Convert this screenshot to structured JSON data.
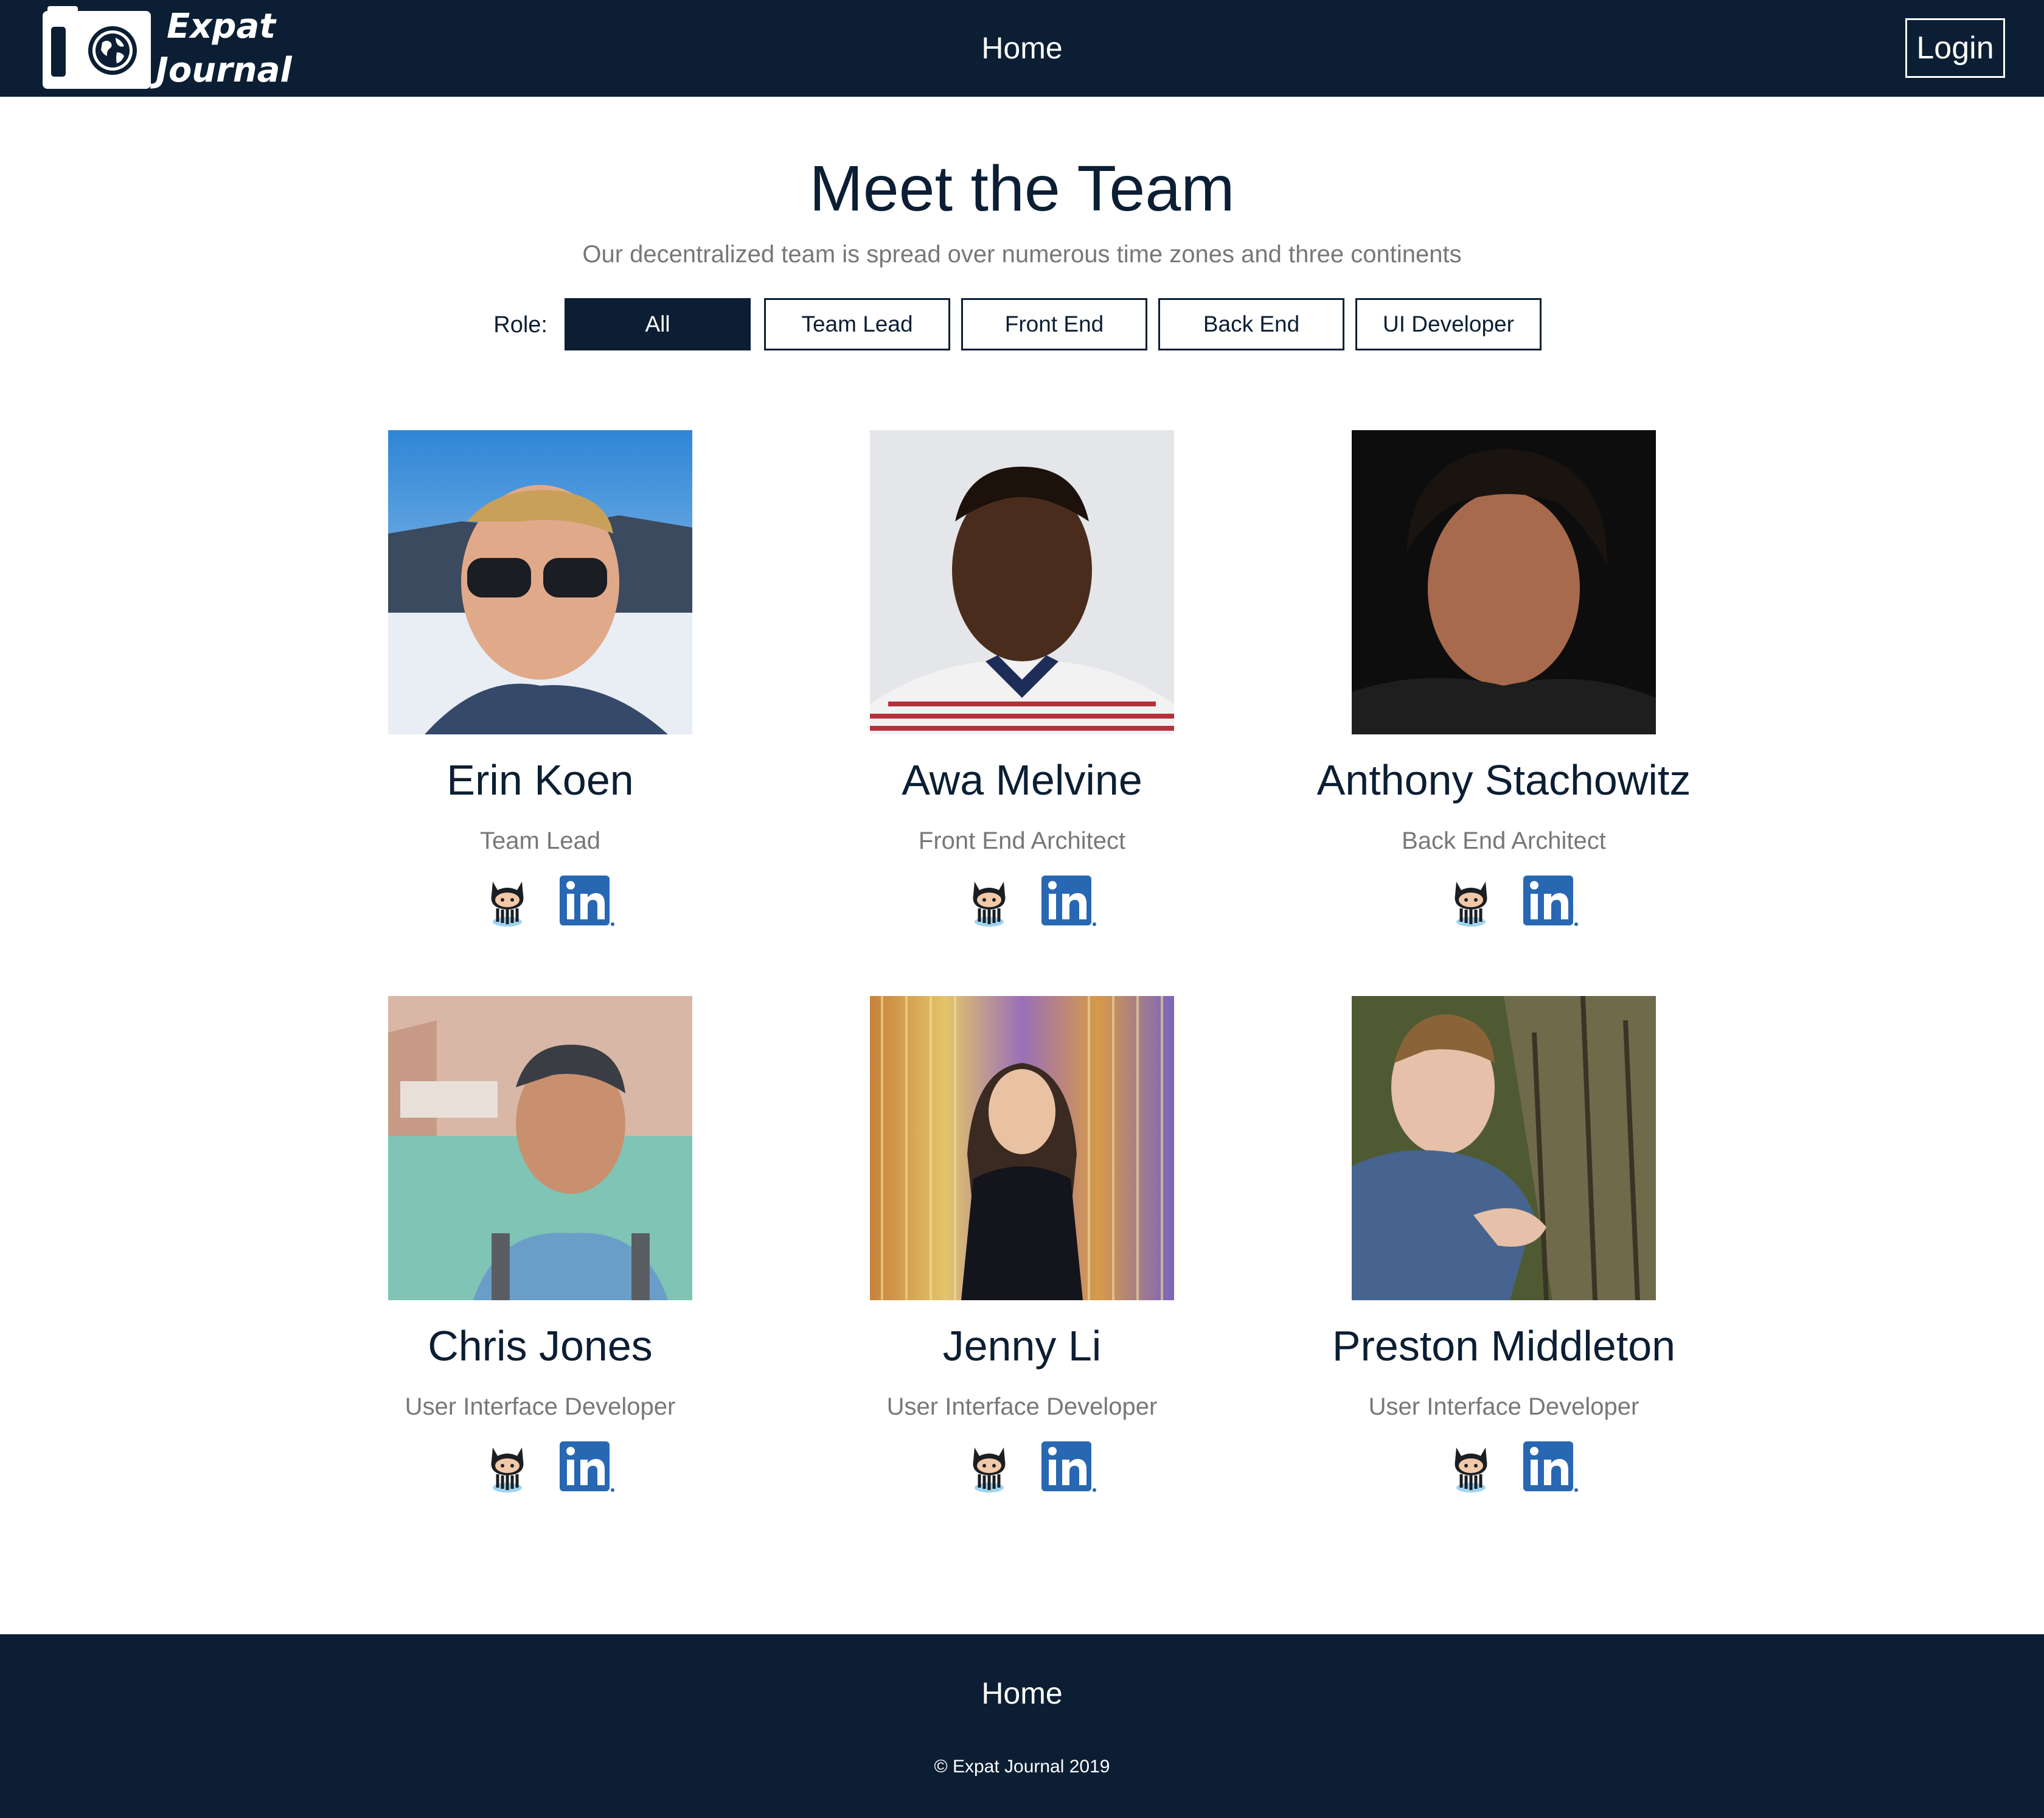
{
  "header": {
    "logo_line1": "Expat",
    "logo_line2": "Journal",
    "nav_home": "Home",
    "login_label": "Login"
  },
  "intro": {
    "title": "Meet the Team",
    "subtitle": "Our decentralized team is spread over numerous time zones and three continents",
    "role_label": "Role:",
    "filters": [
      "All",
      "Team Lead",
      "Front End",
      "Back End",
      "UI Developer"
    ],
    "active_filter": "All"
  },
  "team": [
    {
      "name": "Erin Koen",
      "role": "Team Lead"
    },
    {
      "name": "Awa Melvine",
      "role": "Front End Architect"
    },
    {
      "name": "Anthony Stachowitz",
      "role": "Back End Architect"
    },
    {
      "name": "Chris Jones",
      "role": "User Interface Developer"
    },
    {
      "name": "Jenny Li",
      "role": "User Interface Developer"
    },
    {
      "name": "Preston Middleton",
      "role": "User Interface Developer"
    }
  ],
  "social_icons": [
    "github-octocat-icon",
    "linkedin-icon"
  ],
  "footer": {
    "home": "Home",
    "copyright": "© Expat Journal 2019"
  },
  "colors": {
    "navy": "#0b1e33",
    "muted_text": "#777777",
    "linkedin_blue": "#2867b2",
    "background": "#ffffff"
  }
}
